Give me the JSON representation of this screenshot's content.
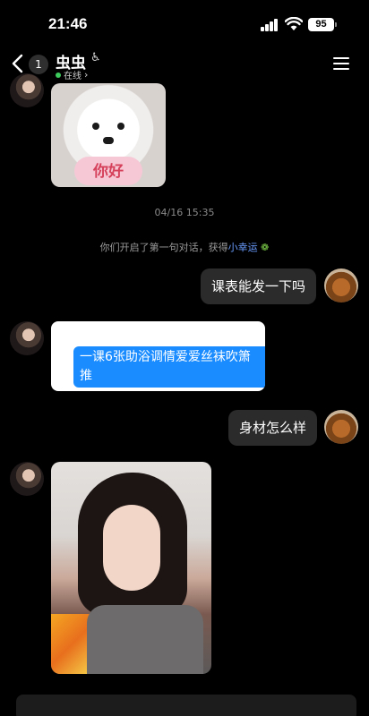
{
  "status_bar": {
    "time": "21:46",
    "battery": "95"
  },
  "header": {
    "unread_count": "1",
    "title": "虫虫",
    "status": "在线"
  },
  "messages": {
    "sticker_caption": "你好",
    "timestamp": "04/16 15:35",
    "notice_prefix": "你们开启了第一句对话，获得",
    "notice_link": "小幸运",
    "notice_icon": "sprout-icon",
    "msg1": "课表能发一下吗",
    "quote_text_line1": "一课6张助浴调情爱爱丝袜吹箫",
    "quote_text_line2": "推",
    "msg2": "身材怎么样"
  },
  "colors": {
    "background": "#000000",
    "bubble": "#2b2b2b",
    "quote_blue": "#1a8cff",
    "online_dot": "#3ecb5d",
    "link": "#6a9cff"
  }
}
